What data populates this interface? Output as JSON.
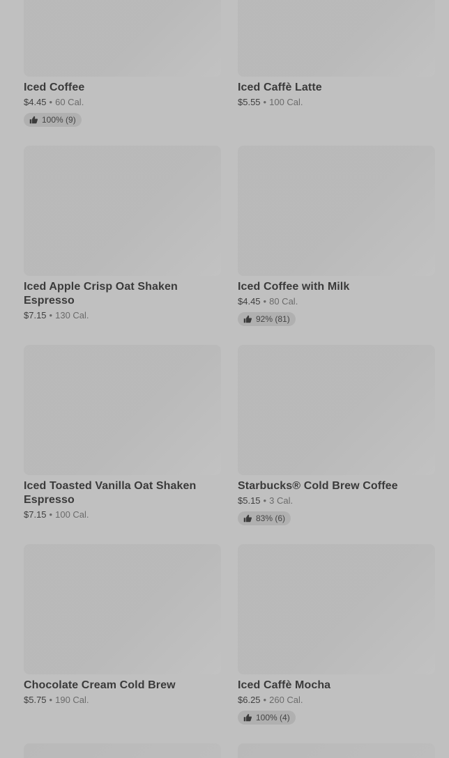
{
  "items": [
    {
      "name": "Iced Coffee",
      "price": "$4.45",
      "calories": "60 Cal.",
      "rating": "100% (9)"
    },
    {
      "name": "Iced Caffè Latte",
      "price": "$5.55",
      "calories": "100 Cal.",
      "rating": ""
    },
    {
      "name": "Iced Apple Crisp Oat Shaken Espresso",
      "price": "$7.15",
      "calories": "130 Cal.",
      "rating": ""
    },
    {
      "name": "Iced Coffee with Milk",
      "price": "$4.45",
      "calories": "80 Cal.",
      "rating": "92% (81)"
    },
    {
      "name": "Iced Toasted Vanilla Oat Shaken Espresso",
      "price": "$7.15",
      "calories": "100 Cal.",
      "rating": ""
    },
    {
      "name": "Starbucks® Cold Brew Coffee",
      "price": "$5.15",
      "calories": "3 Cal.",
      "rating": "83% (6)"
    },
    {
      "name": "Chocolate Cream Cold Brew",
      "price": "$5.75",
      "calories": "190 Cal.",
      "rating": ""
    },
    {
      "name": "Iced Caffè Mocha",
      "price": "$6.25",
      "calories": "260 Cal.",
      "rating": "100% (4)"
    }
  ],
  "meta_separator": "•",
  "icons": {
    "rating": "thumbs-up-icon"
  },
  "colors": {
    "overlay": "#c0c0c0",
    "text": "#3a3a3a",
    "muted": "#6a6a6a"
  }
}
